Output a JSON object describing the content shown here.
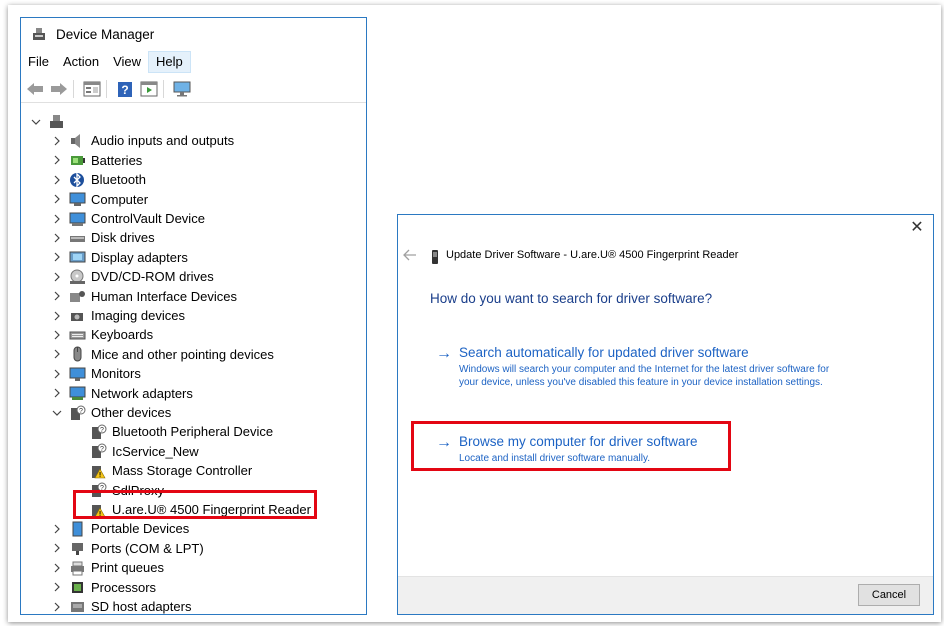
{
  "device_manager": {
    "title": "Device Manager",
    "menu": [
      "File",
      "Action",
      "View",
      "Help"
    ],
    "active_menu": "Help",
    "toolbar": [
      "back-icon",
      "forward-icon",
      "properties-icon",
      "help-icon",
      "run-icon",
      "monitor-icon"
    ],
    "tree": [
      {
        "label": "",
        "icon": "computer-root-icon",
        "expand": "down",
        "level": 0
      },
      {
        "label": "Audio inputs and outputs",
        "icon": "speaker-icon",
        "expand": "right",
        "level": 1
      },
      {
        "label": "Batteries",
        "icon": "battery-icon",
        "expand": "right",
        "level": 1
      },
      {
        "label": "Bluetooth",
        "icon": "bluetooth-icon",
        "expand": "right",
        "level": 1
      },
      {
        "label": "Computer",
        "icon": "computer-icon",
        "expand": "right",
        "level": 1
      },
      {
        "label": "ControlVault Device",
        "icon": "controlvault-icon",
        "expand": "right",
        "level": 1
      },
      {
        "label": "Disk drives",
        "icon": "disk-drive-icon",
        "expand": "right",
        "level": 1
      },
      {
        "label": "Display adapters",
        "icon": "display-adapter-icon",
        "expand": "right",
        "level": 1
      },
      {
        "label": "DVD/CD-ROM drives",
        "icon": "dvd-icon",
        "expand": "right",
        "level": 1
      },
      {
        "label": "Human Interface Devices",
        "icon": "hid-icon",
        "expand": "right",
        "level": 1
      },
      {
        "label": "Imaging devices",
        "icon": "camera-icon",
        "expand": "right",
        "level": 1
      },
      {
        "label": "Keyboards",
        "icon": "keyboard-icon",
        "expand": "right",
        "level": 1
      },
      {
        "label": "Mice and other pointing devices",
        "icon": "mouse-icon",
        "expand": "right",
        "level": 1
      },
      {
        "label": "Monitors",
        "icon": "monitor-icon",
        "expand": "right",
        "level": 1
      },
      {
        "label": "Network adapters",
        "icon": "network-icon",
        "expand": "right",
        "level": 1
      },
      {
        "label": "Other devices",
        "icon": "unknown-device-icon",
        "expand": "down",
        "level": 1
      },
      {
        "label": "Bluetooth Peripheral Device",
        "icon": "unknown-device-icon",
        "expand": "none",
        "level": 2
      },
      {
        "label": "IcService_New",
        "icon": "unknown-device-icon",
        "expand": "none",
        "level": 2
      },
      {
        "label": "Mass Storage Controller",
        "icon": "warning-device-icon",
        "expand": "none",
        "level": 2
      },
      {
        "label": "SdlProxy",
        "icon": "unknown-device-icon",
        "expand": "none",
        "level": 2
      },
      {
        "label": "U.are.U® 4500 Fingerprint Reader",
        "icon": "warning-device-icon",
        "expand": "none",
        "level": 2
      },
      {
        "label": "Portable Devices",
        "icon": "portable-device-icon",
        "expand": "right",
        "level": 1
      },
      {
        "label": "Ports (COM & LPT)",
        "icon": "port-icon",
        "expand": "right",
        "level": 1
      },
      {
        "label": "Print queues",
        "icon": "printer-icon",
        "expand": "right",
        "level": 1
      },
      {
        "label": "Processors",
        "icon": "processor-icon",
        "expand": "right",
        "level": 1
      },
      {
        "label": "SD host adapters",
        "icon": "sd-icon",
        "expand": "right",
        "level": 1
      }
    ]
  },
  "dialog": {
    "title": "Update Driver Software - U.are.U® 4500 Fingerprint Reader",
    "question": "How do you want to search for driver software?",
    "option_auto": {
      "title": "Search automatically for updated driver software",
      "description": "Windows will search your computer and the Internet for the latest driver software for your device, unless you've disabled this feature in your device installation settings."
    },
    "option_browse": {
      "title": "Browse my computer for driver software",
      "description": "Locate and install driver software manually."
    },
    "cancel_label": "Cancel"
  },
  "colors": {
    "link_blue": "#1d63c4",
    "heading_blue": "#1a3e8a",
    "highlight_red": "#e30613",
    "window_border": "#2b79c2"
  }
}
